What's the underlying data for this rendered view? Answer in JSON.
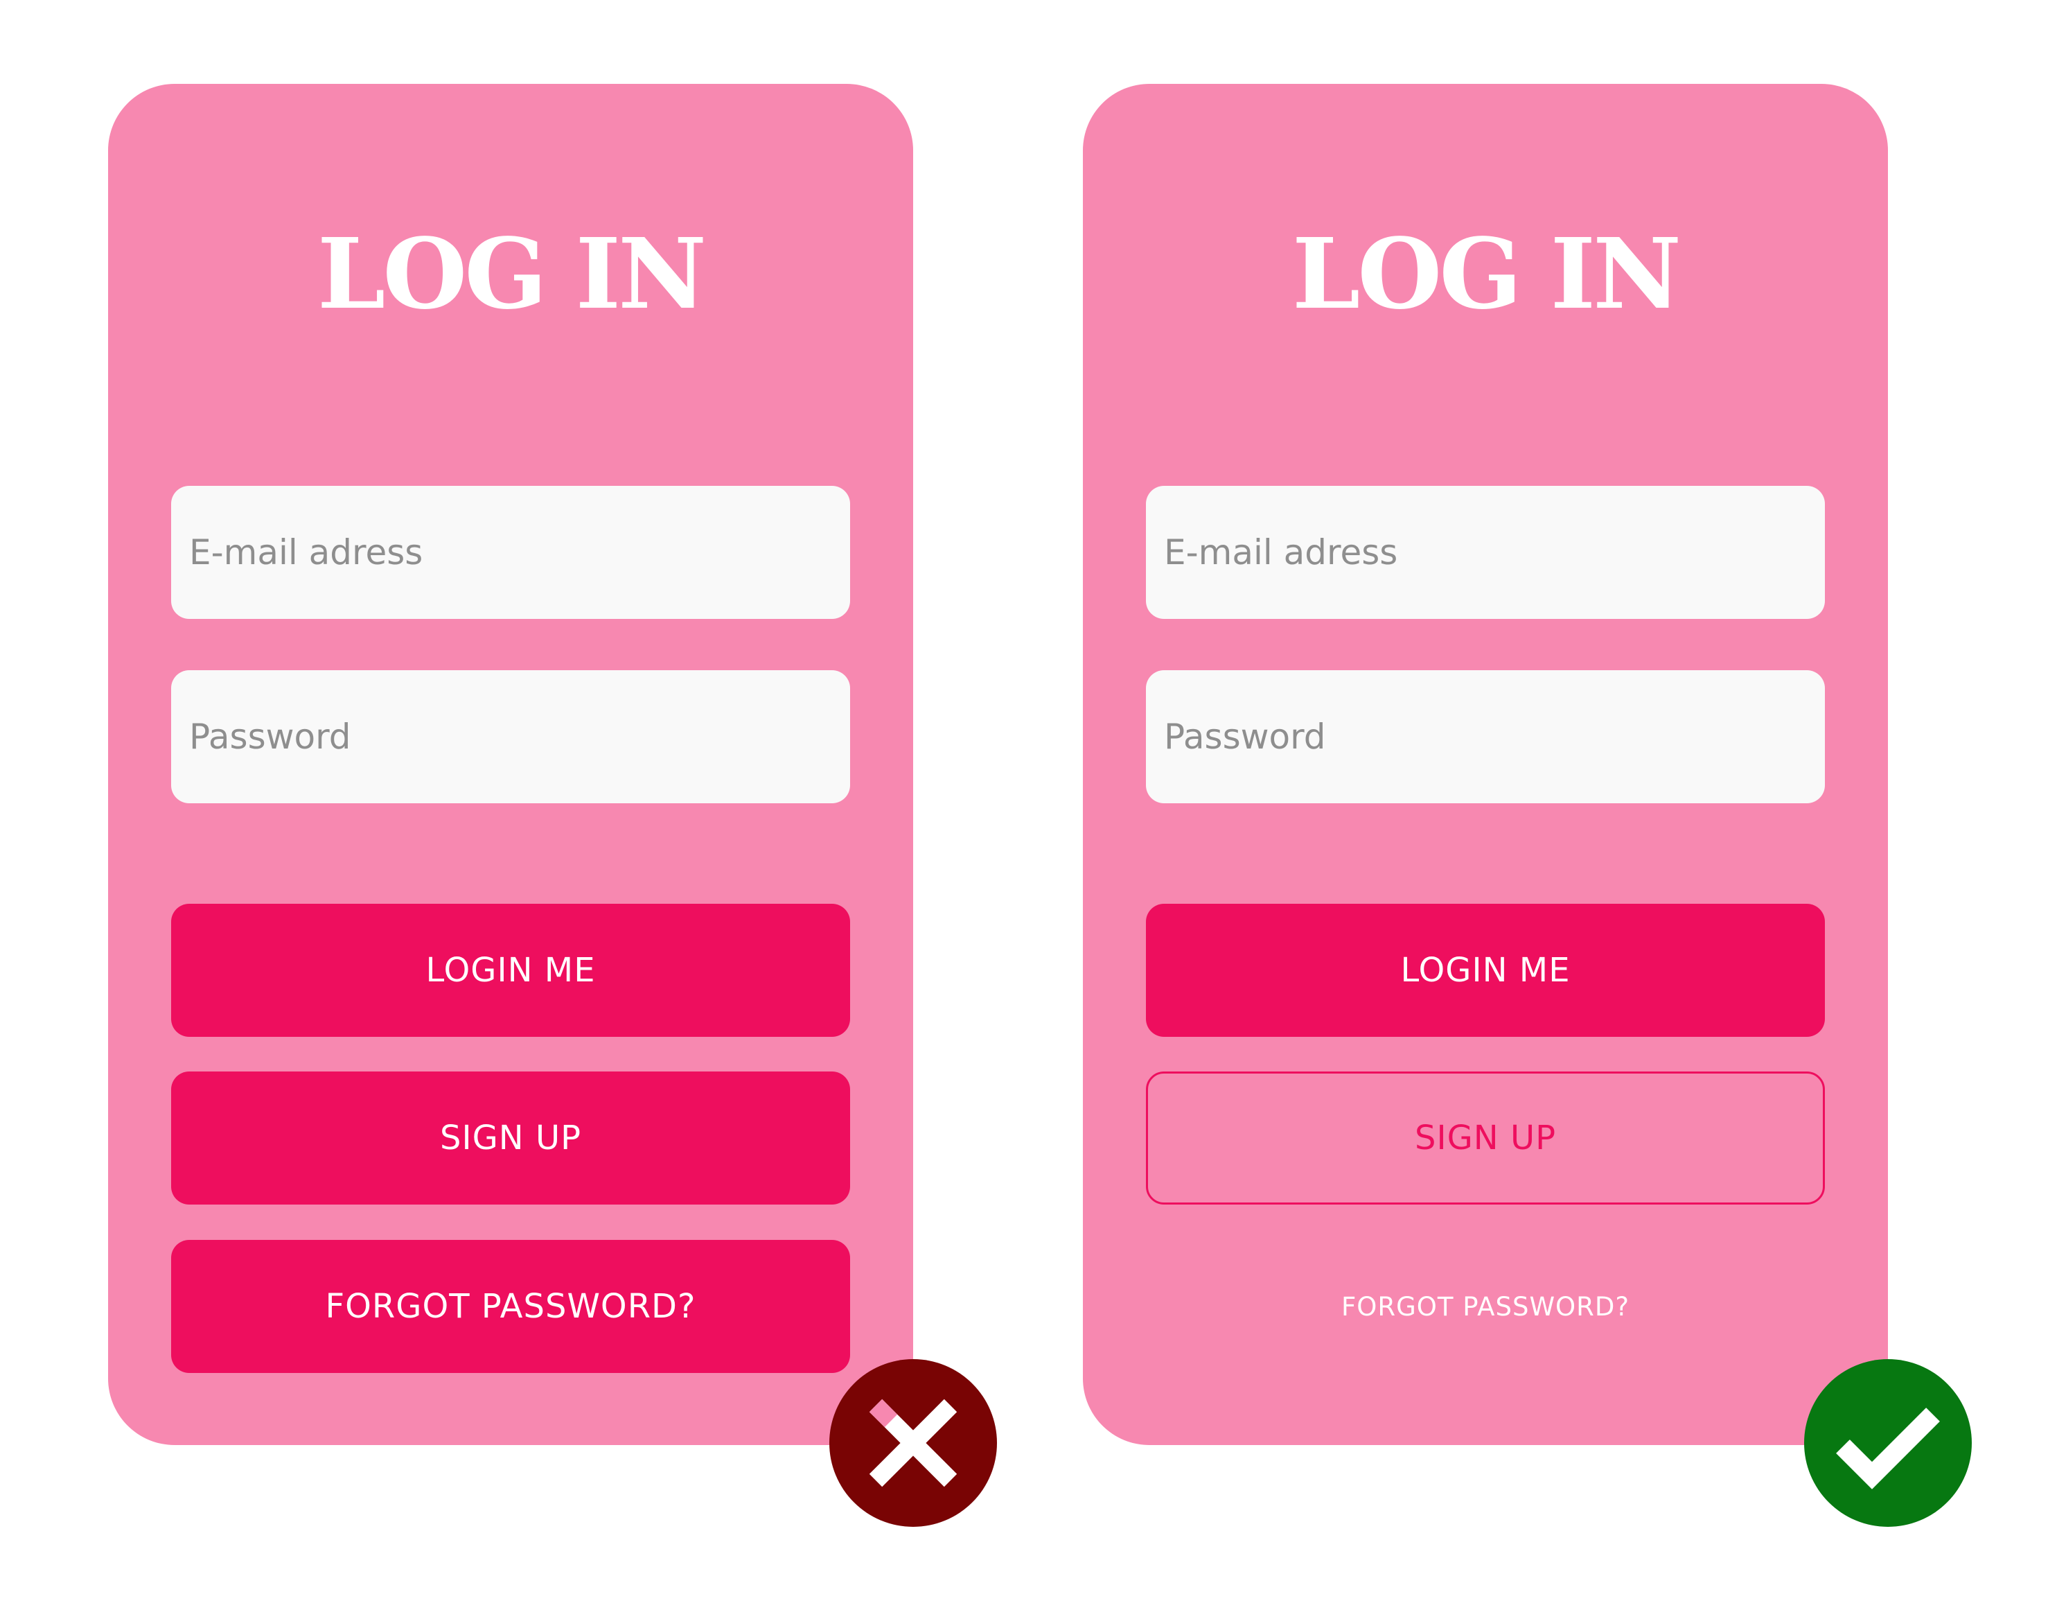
{
  "examples": [
    {
      "verdict": "incorrect",
      "title": "LOG IN",
      "email_placeholder": "E-mail adress",
      "password_placeholder": "Password",
      "login_label": "LOGIN ME",
      "signup_label": "SIGN UP",
      "forgot_label": "FORGOT PASSWORD?",
      "badge_icon": "cross-icon"
    },
    {
      "verdict": "correct",
      "title": "LOG IN",
      "email_placeholder": "E-mail adress",
      "password_placeholder": "Password",
      "login_label": "LOGIN ME",
      "signup_label": "SIGN UP",
      "forgot_label": "FORGOT PASSWORD?",
      "badge_icon": "checkmark-icon"
    }
  ],
  "colors": {
    "card_background": "#f788b0",
    "primary_button": "#ee0e5e",
    "field_background": "#f9f9f9",
    "placeholder_text": "#8e8e8e",
    "incorrect_badge": "#790404",
    "correct_badge": "#077811"
  }
}
